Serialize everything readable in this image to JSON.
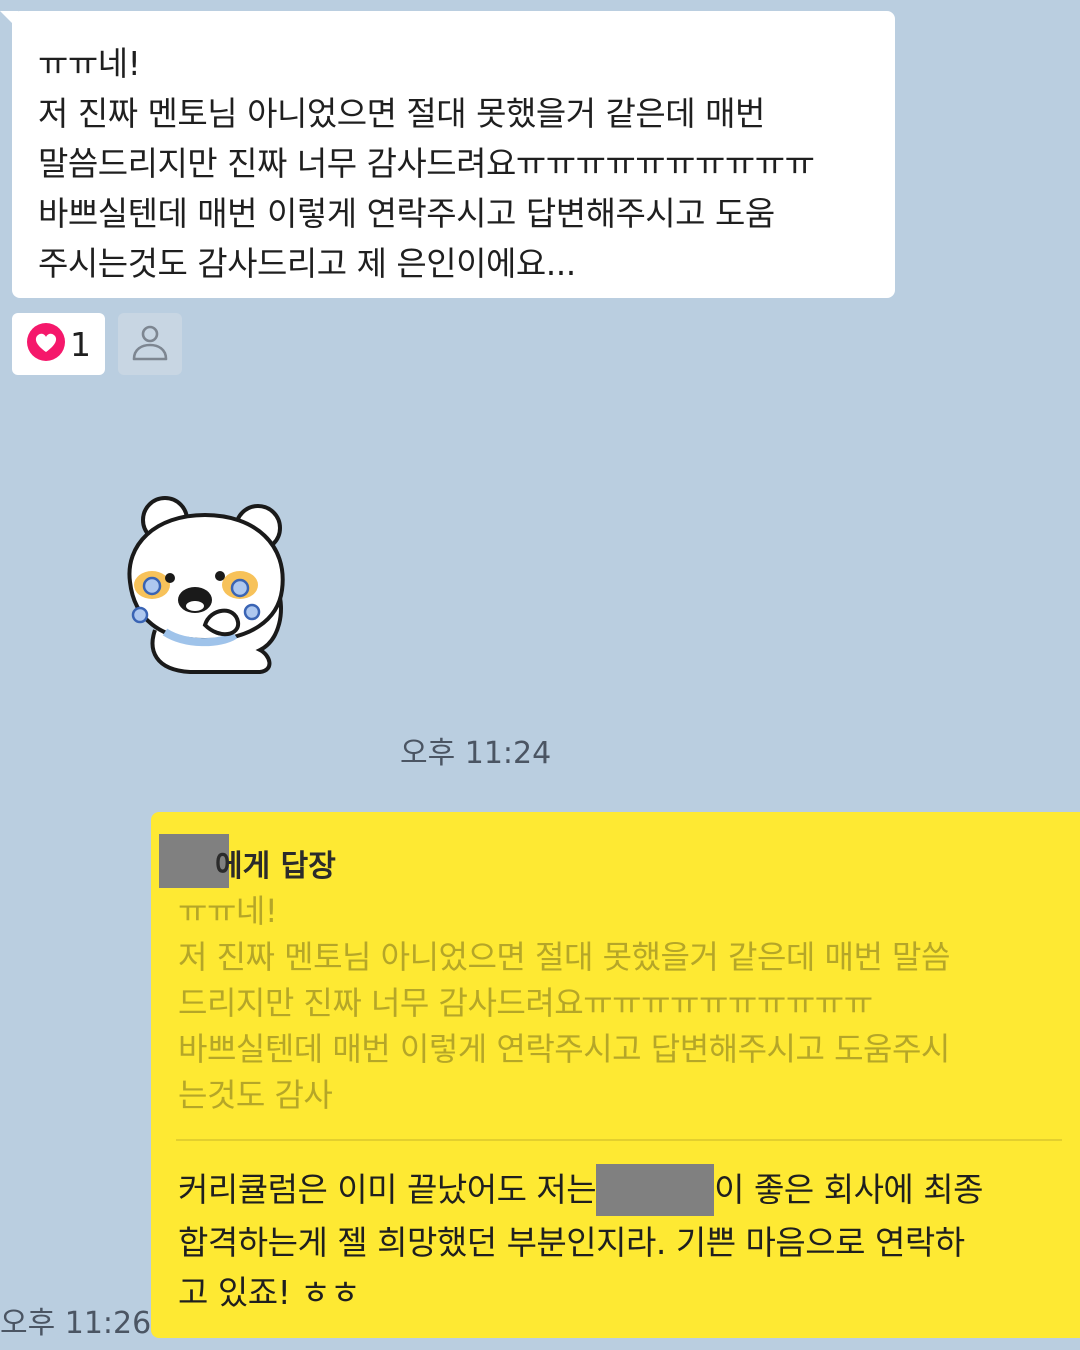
{
  "incoming_message": {
    "lines": [
      "ㅠㅠ네!",
      "저 진짜 멘토님 아니었으면 절대 못했을거 같은데 매번",
      "말씀드리지만 진짜 너무 감사드려요ㅠㅠㅠㅠㅠㅠㅠㅠㅠㅠ",
      "바쁘실텐데 매번 이렇게 연락주시고 답변해주시고 도움",
      "주시는것도 감사드리고 제 은인이에요..."
    ]
  },
  "reaction": {
    "icon": "heart-icon",
    "color": "#f5186b",
    "count": "1"
  },
  "sticker": {
    "icon": "crying-bear-sticker"
  },
  "time_received": "오후 11:24",
  "time_sent": "오후 11:26",
  "reply": {
    "header_label": "에게 답장",
    "quoted_lines": [
      "ㅠㅠ네!",
      "저 진짜 멘토님 아니었으면 절대 못했을거 같은데 매번 말씀",
      "드리지만 진짜 너무 감사드려요ㅠㅠㅠㅠㅠㅠㅠㅠㅠㅠ",
      "바쁘실텐데 매번 이렇게 연락주시고 답변해주시고 도움주시",
      "는것도 감사"
    ],
    "answer": {
      "line1_before": "커리큘럼은 이미 끝났어도 저는",
      "line1_after": "이 좋은 회사에 최종",
      "line2": "합격하는게 젤 희망했던 부분인지라. 기쁜 마음으로 연락하",
      "line3": "고 있죠! ㅎㅎ"
    }
  },
  "colors": {
    "background": "#bacee0",
    "bubble_incoming": "#ffffff",
    "bubble_outgoing": "#fee933",
    "redaction": "#808080"
  }
}
